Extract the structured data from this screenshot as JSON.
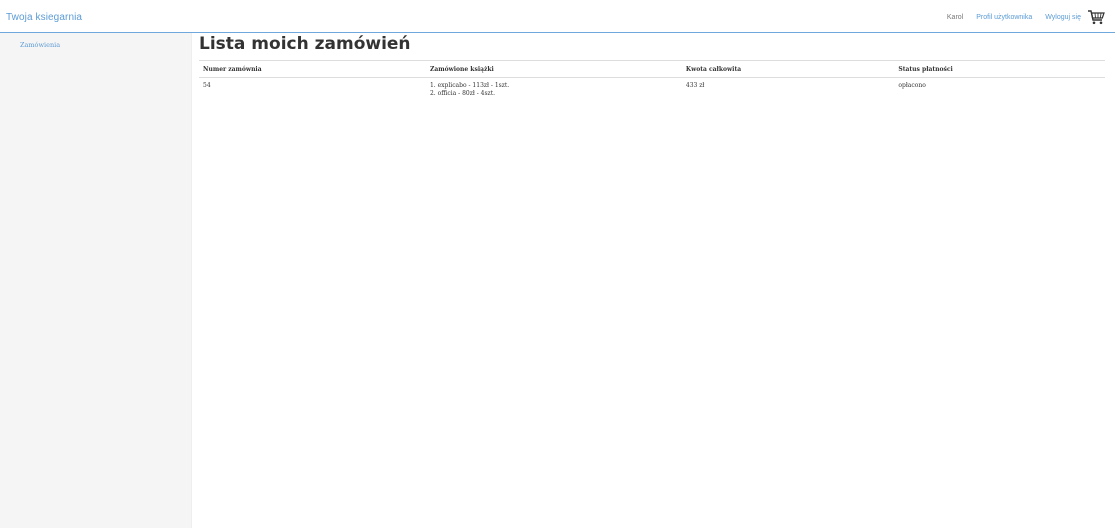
{
  "header": {
    "brand": "Twoja ksiegarnia",
    "user_name": "Karol",
    "profile_link": "Profil użytkownika",
    "logout_link": "Wyloguj się",
    "cart_icon": "shopping-cart-icon"
  },
  "sidebar": {
    "items": [
      {
        "label": "Zamówienia"
      }
    ]
  },
  "main": {
    "title": "Lista moich zamówień",
    "table": {
      "columns": [
        "Numer zamównia",
        "Zamówione książki",
        "Kwota całkowita",
        "Status płatności"
      ],
      "rows": [
        {
          "order_number": "54",
          "books": [
            "1. explicabo - 113zł - 1szt.",
            "2. officia - 80zł - 4szt."
          ],
          "total": "433 zł",
          "status": "opłacono"
        }
      ]
    }
  },
  "colors": {
    "accent": "#5b9bd5",
    "sidebar_bg": "#f5f5f5",
    "text": "#333333"
  }
}
